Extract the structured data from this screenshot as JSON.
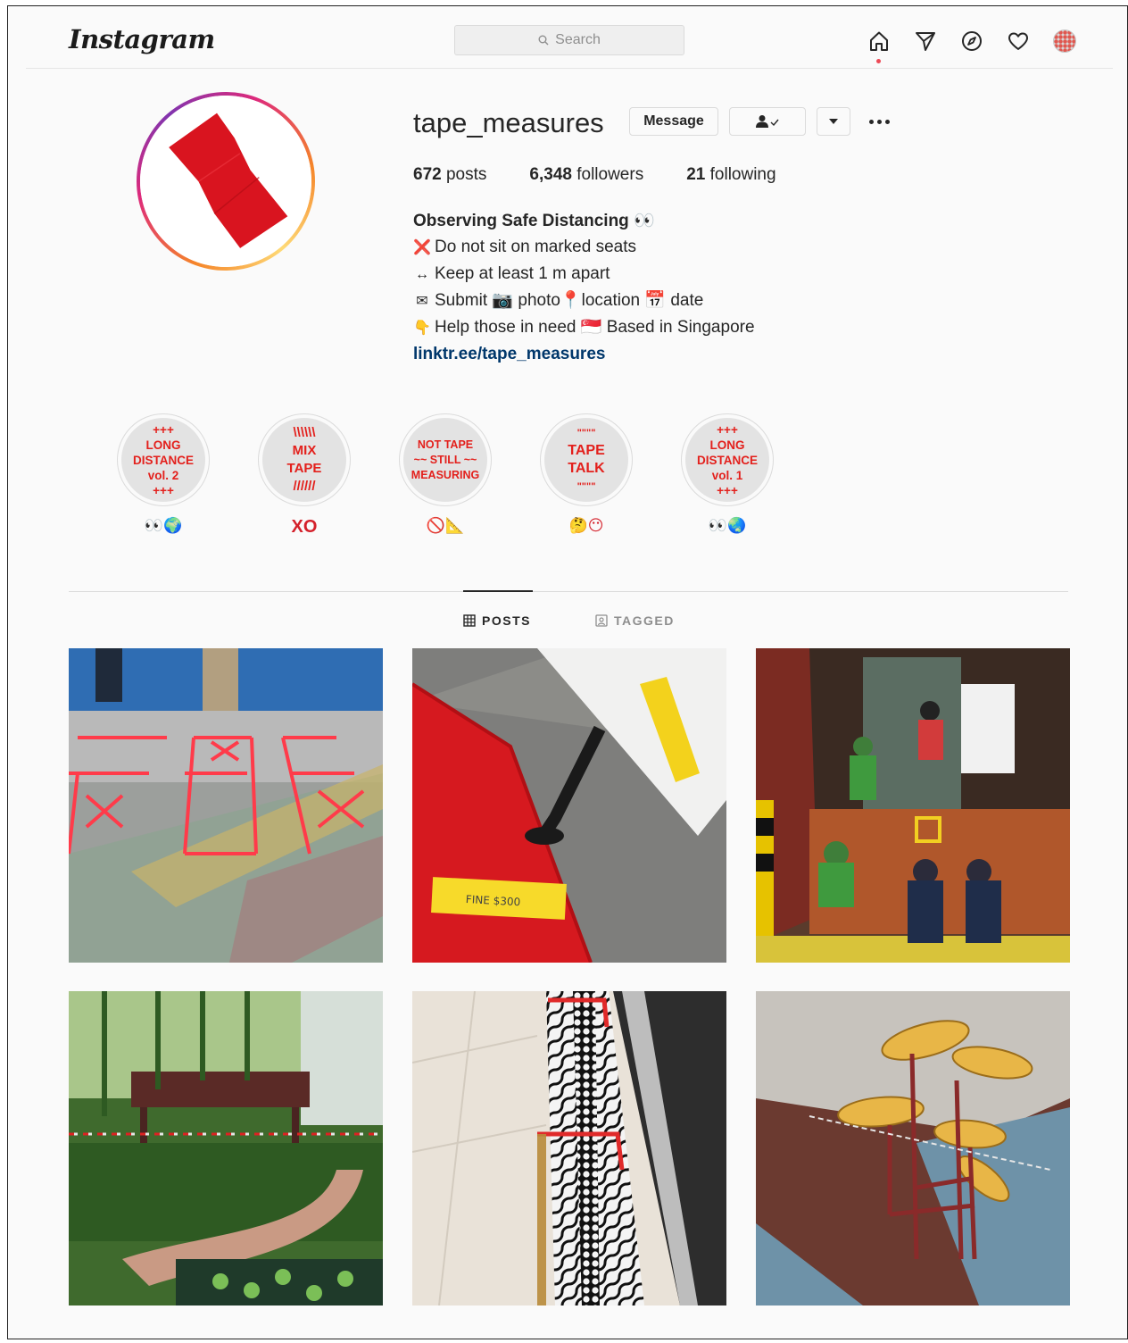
{
  "header": {
    "logo": "Instagram",
    "search_placeholder": "Search",
    "nav": [
      "home-icon",
      "direct-icon",
      "explore-icon",
      "activity-icon",
      "profile-avatar"
    ]
  },
  "profile": {
    "username": "tape_measures",
    "message_label": "Message",
    "posts_count": "672",
    "posts_label": " posts",
    "followers_count": "6,348",
    "followers_label": " followers",
    "following_count": "21",
    "following_label": " following",
    "bio": {
      "name": "Observing Safe Distancing",
      "name_emoji": "👀",
      "line1_icon": "❌",
      "line1": "Do not sit on marked seats",
      "line2_icon": "↔",
      "line2": "Keep at least 1 m apart",
      "line3_icon": "✉",
      "line3": "Submit",
      "line3_b": "photo",
      "line3_c": "location",
      "line3_d": "date",
      "line4_icon": "👇",
      "line4": "Help those in need",
      "line4_b": "Based in Singapore",
      "link": "linktr.ee/tape_measures"
    }
  },
  "highlights": [
    {
      "lines": [
        "+++",
        "LONG",
        "DISTANCE",
        "vol. 2",
        "+++"
      ],
      "label": "👀🌍"
    },
    {
      "lines": [
        "\\\\\\\\\\\\",
        "MIX",
        "TAPE",
        "//////"
      ],
      "label": "XO"
    },
    {
      "lines": [
        "NOT TAPE",
        "~~ STILL ~~",
        "MEASURING"
      ],
      "label": "🚫📐"
    },
    {
      "lines": [
        "\"\"\"\"",
        "TAPE",
        "TALK",
        "\"\"\"\""
      ],
      "label": "🤔😶"
    },
    {
      "lines": [
        "+++",
        "LONG",
        "DISTANCE",
        "vol. 1",
        "+++"
      ],
      "label": "👀🌏"
    }
  ],
  "tabs": {
    "posts": "POSTS",
    "tagged": "TAGGED"
  },
  "posts": [
    {
      "id": "post-1",
      "subject": "floor-tape-grid"
    },
    {
      "id": "post-2",
      "subject": "red-seat-yellow-tape",
      "tape_text": "FINE $300"
    },
    {
      "id": "post-3",
      "subject": "shop-entrance-officers"
    },
    {
      "id": "post-4",
      "subject": "park-barrier-tape"
    },
    {
      "id": "post-5",
      "subject": "tiled-floor-red-tape"
    },
    {
      "id": "post-6",
      "subject": "playground-taped"
    }
  ],
  "colors": {
    "accent_red": "#e3201c",
    "link": "#00376b",
    "border": "#dbdbdb"
  }
}
